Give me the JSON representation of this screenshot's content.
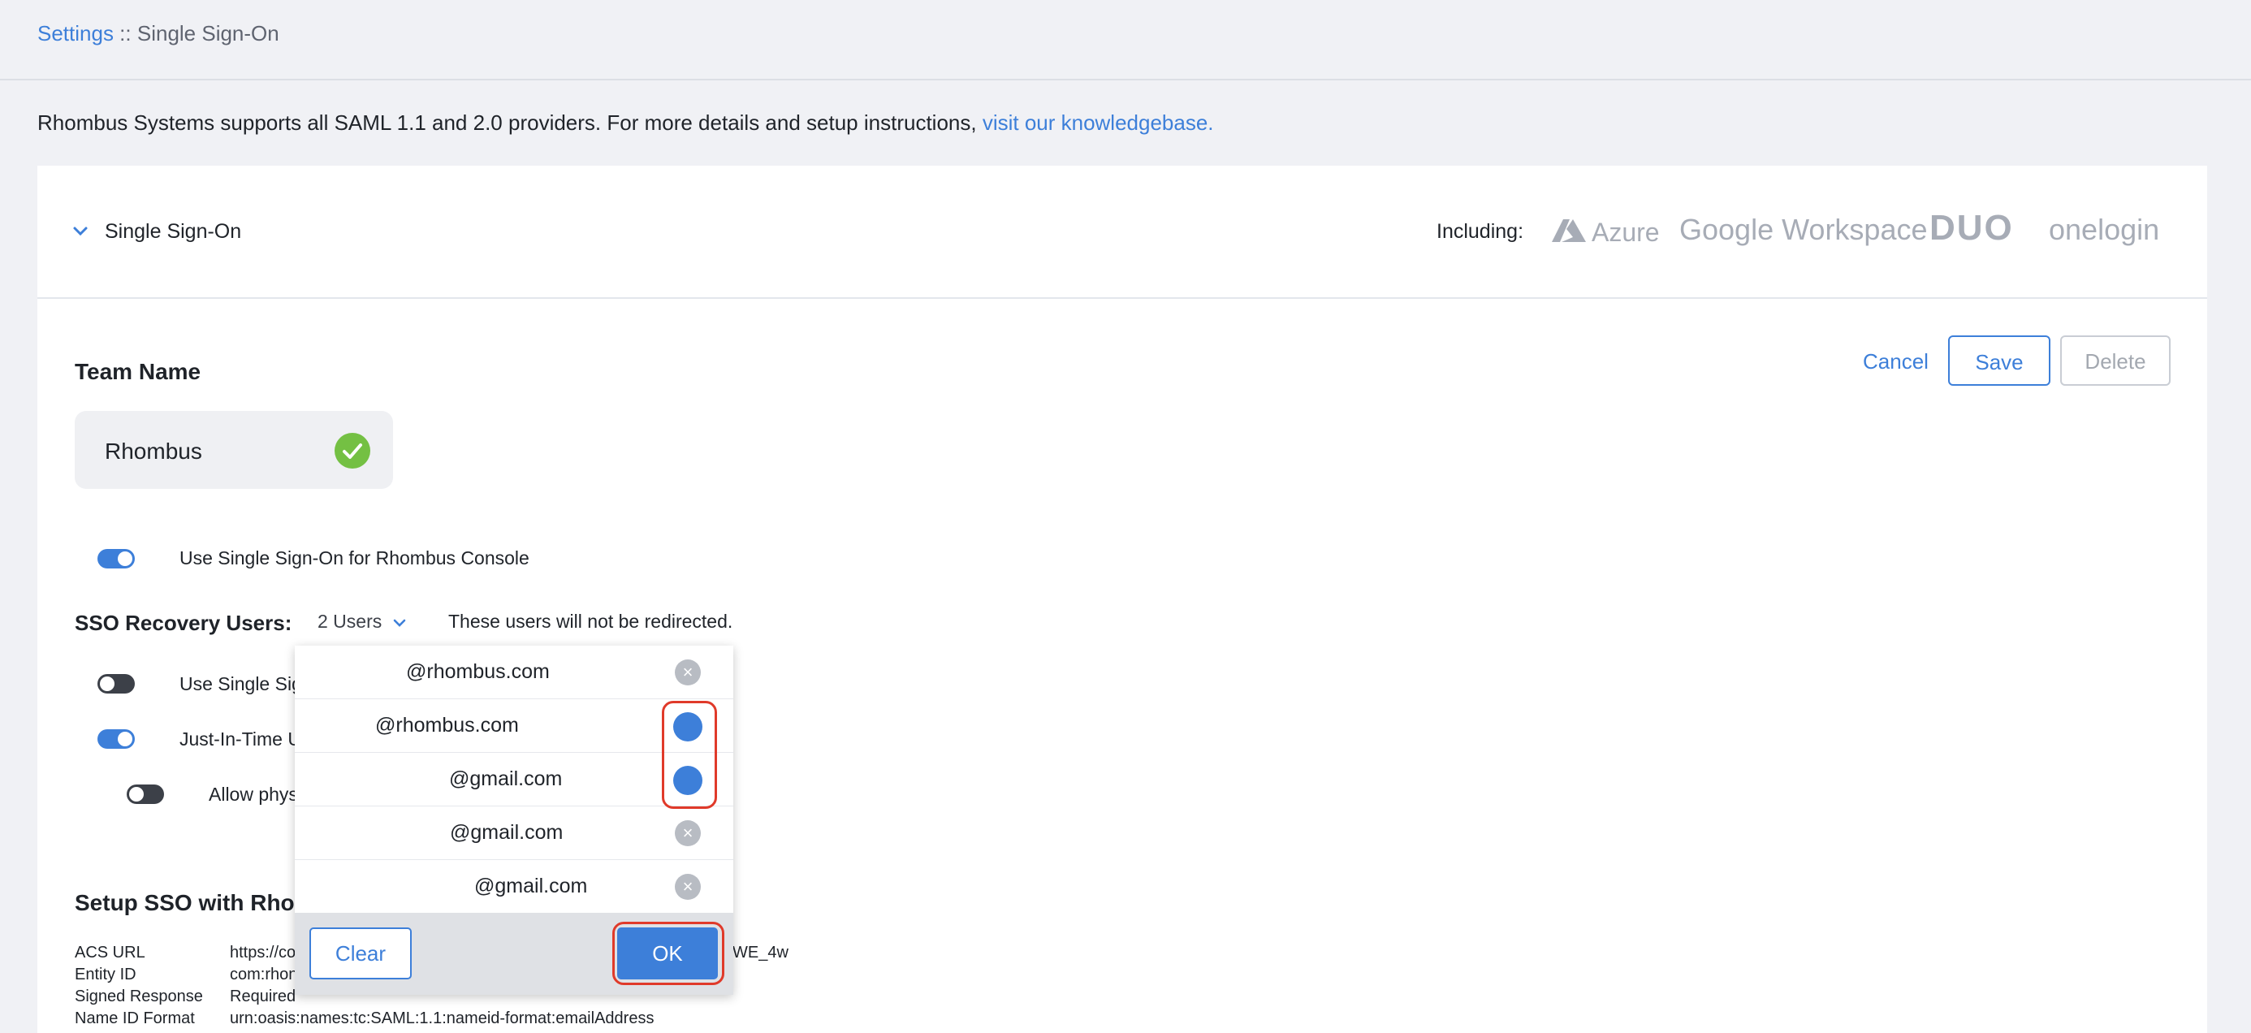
{
  "breadcrumb": {
    "parent": "Settings",
    "separator": " :: ",
    "current": "Single Sign-On"
  },
  "info": {
    "text": "Rhombus Systems supports all SAML 1.1 and 2.0 providers. For more details and setup instructions, ",
    "link": "visit our knowledgebase."
  },
  "panel": {
    "title": "Single Sign-On",
    "including_label": "Including:",
    "logos": [
      "Azure",
      "Google Workspace",
      "DUO",
      "onelogin"
    ]
  },
  "actions": {
    "cancel": "Cancel",
    "save": "Save",
    "delete": "Delete"
  },
  "team": {
    "label": "Team Name",
    "value": "Rhombus"
  },
  "options": {
    "console_sso": {
      "label": "Use Single Sign-On for Rhombus Console",
      "enabled": true
    },
    "opt2": {
      "label": "Use Single Sig",
      "enabled": false
    },
    "opt3": {
      "label": "Just-In-Time U",
      "enabled": true
    },
    "opt4": {
      "label": "Allow phys",
      "enabled": false
    }
  },
  "recovery": {
    "label": "SSO Recovery Users:",
    "selected": "2 Users",
    "note": "These users will not be redirected."
  },
  "dropdown": {
    "items": [
      {
        "email": "@rhombus.com",
        "state": "removable"
      },
      {
        "email": "@rhombus.com",
        "state": "selected"
      },
      {
        "email": "@gmail.com",
        "state": "selected"
      },
      {
        "email": "@gmail.com",
        "state": "removable"
      },
      {
        "email": "@gmail.com",
        "state": "removable"
      }
    ],
    "clear_label": "Clear",
    "ok_label": "OK"
  },
  "setup": {
    "title": "Setup SSO with Rho",
    "rows": [
      {
        "key": "ACS URL",
        "value": "https://co",
        "value_tail": "WE_4w"
      },
      {
        "key": "Entity ID",
        "value": "com:rhon"
      },
      {
        "key": "Signed Response",
        "value": "Required"
      },
      {
        "key": "Name ID Format",
        "value": "urn:oasis:names:tc:SAML:1.1:nameid-format:emailAddress"
      }
    ]
  },
  "colors": {
    "accent": "#3d7fd9",
    "success": "#74c043",
    "highlight": "#e03a2a"
  }
}
